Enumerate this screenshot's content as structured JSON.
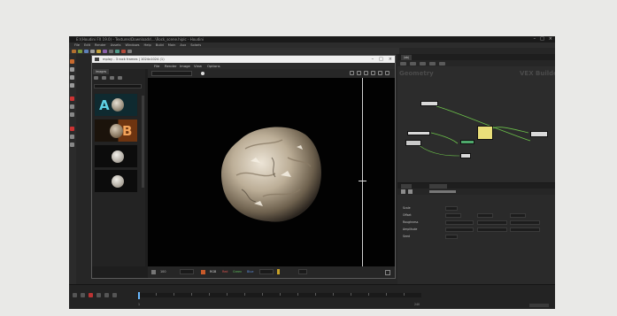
{
  "app": {
    "title_bar": "E:\\(Houdini FX 19.0) - Textures\\Downloads\\...\\Rock_scene.hiplc - Houdini",
    "menu": [
      "File",
      "Edit",
      "Render",
      "Assets",
      "Windows",
      "Help",
      "Build",
      "Main",
      "Aux",
      "Solaris"
    ],
    "colors": {
      "window_bg": "#262626",
      "selected_node": "#eadf7a",
      "playhead": "#69b9ff"
    }
  },
  "viewer": {
    "title": "mplay - 3 rock frames | 1024x1024 (1)",
    "menu": [
      "File",
      "Render",
      "Image",
      "View",
      "Options"
    ],
    "thumb_tab": "Images",
    "label_a": "A",
    "label_b": "B",
    "footer": {
      "zoom": "100",
      "channels": [
        "RGB",
        "Red",
        "Green",
        "Blue"
      ]
    }
  },
  "node_editor": {
    "tab": "/obj",
    "context_left": "Geometry",
    "context_right": "VEX Builder"
  },
  "params": {
    "rows": [
      "Scale",
      "Offset",
      "Roughness",
      "Amplitude",
      "Seed"
    ]
  },
  "timeline": {
    "start": "1",
    "end": "240"
  }
}
